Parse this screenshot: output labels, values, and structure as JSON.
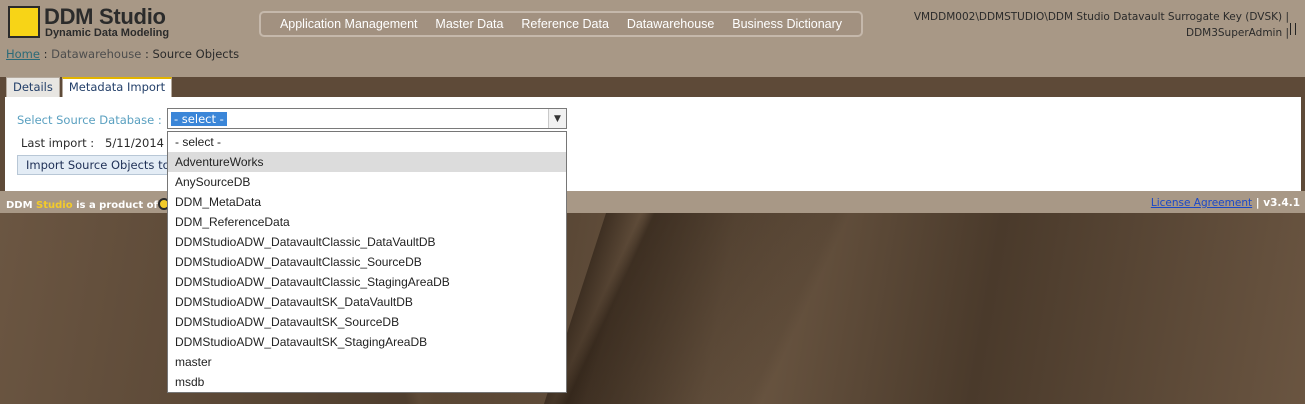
{
  "header": {
    "logo_title": "DDM Studio",
    "logo_subtitle": "Dynamic Data Modeling",
    "nav": [
      {
        "label": "Application Management"
      },
      {
        "label": "Master Data"
      },
      {
        "label": "Reference Data"
      },
      {
        "label": "Datawarehouse"
      },
      {
        "label": "Business Dictionary"
      }
    ],
    "connection": "VMDDM002\\DDMSTUDIO\\DDM Studio Datavault Surrogate Key (DVSK) |",
    "user": "DDM3SuperAdmin |"
  },
  "breadcrumb": {
    "home": "Home",
    "sep1": " : ",
    "middle": "Datawarehouse",
    "sep2": " : ",
    "current": "Source Objects"
  },
  "tabs": [
    {
      "label": "Details",
      "active": false
    },
    {
      "label": "Metadata Import",
      "active": true
    }
  ],
  "form": {
    "source_label": "Select Source Database :",
    "selected_value": "- select -",
    "last_import_label": "Last import :",
    "last_import_value": "5/11/2014",
    "import_button": "Import Source Objects to M"
  },
  "dropdown": {
    "options": [
      "- select -",
      "AdventureWorks",
      "AnySourceDB",
      "DDM_MetaData",
      "DDM_ReferenceData",
      "DDMStudioADW_DatavaultClassic_DataVaultDB",
      "DDMStudioADW_DatavaultClassic_SourceDB",
      "DDMStudioADW_DatavaultClassic_StagingAreaDB",
      "DDMStudioADW_DatavaultSK_DataVaultDB",
      "DDMStudioADW_DatavaultSK_SourceDB",
      "DDMStudioADW_DatavaultSK_StagingAreaDB",
      "master",
      "msdb"
    ],
    "hovered_index": 1
  },
  "footer": {
    "product_prefix": "DDM ",
    "product_studio": "Studio",
    "product_suffix": " is a product of",
    "license_link": "License Agreement",
    "version": " | v3.4.1"
  },
  "colors": {
    "header_bg": "#a89886",
    "logo_yellow": "#f7d417",
    "select_highlight": "#3b86d8",
    "link_blue": "#1a48c8"
  }
}
